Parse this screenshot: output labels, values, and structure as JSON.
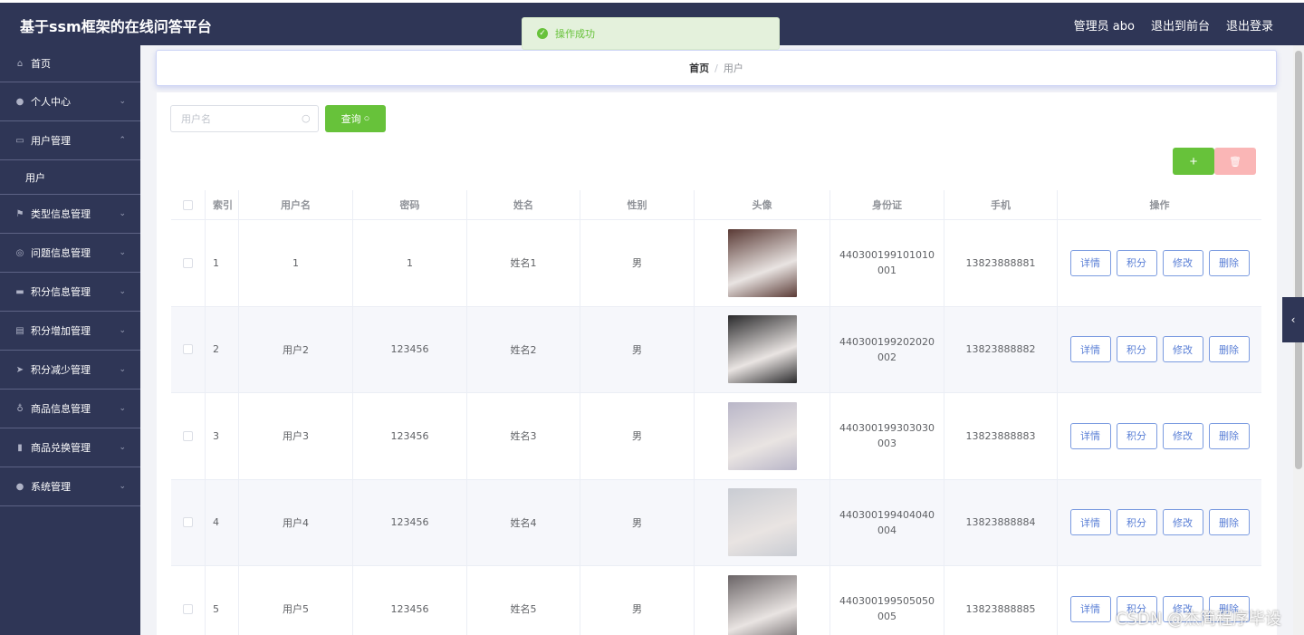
{
  "app": {
    "title": "基于ssm框架的在线问答平台"
  },
  "header": {
    "user": "管理员 abo",
    "front_link": "退出到前台",
    "logout": "退出登录"
  },
  "toast": {
    "message": "操作成功"
  },
  "sidebar": {
    "items": [
      {
        "label": "首页",
        "icon": "home-icon"
      },
      {
        "label": "个人中心",
        "icon": "user-icon"
      },
      {
        "label": "用户管理",
        "icon": "chat-icon",
        "expanded": true
      },
      {
        "label": "类型信息管理",
        "icon": "flag-icon"
      },
      {
        "label": "问题信息管理",
        "icon": "globe-icon"
      },
      {
        "label": "积分信息管理",
        "icon": "briefcase-icon"
      },
      {
        "label": "积分增加管理",
        "icon": "document-icon"
      },
      {
        "label": "积分减少管理",
        "icon": "send-icon"
      },
      {
        "label": "商品信息管理",
        "icon": "microphone-icon"
      },
      {
        "label": "商品兑换管理",
        "icon": "bar-chart-icon"
      },
      {
        "label": "系统管理",
        "icon": "user-icon"
      }
    ],
    "submenu": "用户"
  },
  "breadcrumb": {
    "home": "首页",
    "sep": "/",
    "current": "用户"
  },
  "search": {
    "placeholder": "用户名",
    "button": "查询"
  },
  "toolbar": {
    "add": "+",
    "delete": "🗑"
  },
  "table": {
    "headers": [
      "索引",
      "用户名",
      "密码",
      "姓名",
      "性别",
      "头像",
      "身份证",
      "手机",
      "操作"
    ],
    "rows": [
      {
        "index": "1",
        "username": "1",
        "password": "1",
        "name": "姓名1",
        "gender": "男",
        "id_card": "440300199101010001",
        "phone": "13823888881",
        "avatar_color": "#5a3a35"
      },
      {
        "index": "2",
        "username": "用户2",
        "password": "123456",
        "name": "姓名2",
        "gender": "男",
        "id_card": "440300199202020002",
        "phone": "13823888882",
        "avatar_color": "#2a2a2c"
      },
      {
        "index": "3",
        "username": "用户3",
        "password": "123456",
        "name": "姓名3",
        "gender": "男",
        "id_card": "440300199303030003",
        "phone": "13823888883",
        "avatar_color": "#b9b6c8"
      },
      {
        "index": "4",
        "username": "用户4",
        "password": "123456",
        "name": "姓名4",
        "gender": "男",
        "id_card": "440300199404040004",
        "phone": "13823888884",
        "avatar_color": "#c9ccd3"
      },
      {
        "index": "5",
        "username": "用户5",
        "password": "123456",
        "name": "姓名5",
        "gender": "男",
        "id_card": "440300199505050005",
        "phone": "13823888885",
        "avatar_color": "#6a6466"
      }
    ],
    "ops": [
      "详情",
      "积分",
      "修改",
      "删除"
    ]
  },
  "watermark": "CSDN @杰简程序毕设"
}
